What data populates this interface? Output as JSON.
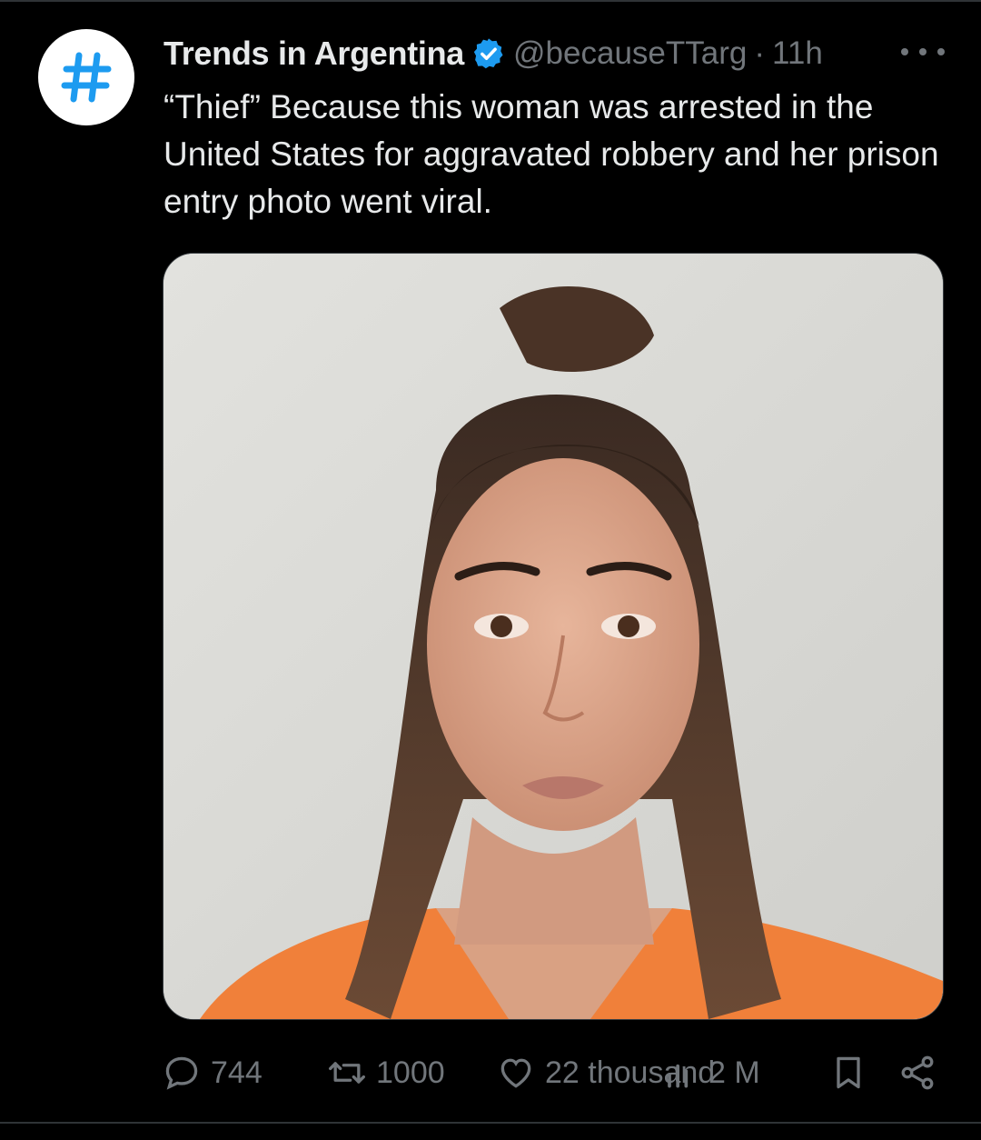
{
  "tweet": {
    "avatar_icon": "hashtag-icon",
    "display_name": "Trends in Argentina",
    "verified_icon": "verified-badge-icon",
    "handle": "@becauseTTarg",
    "separator": "·",
    "time": "11h",
    "text": "“Thief” Because this woman was arrested in the United States for aggravated robbery and her prison entry photo went viral.",
    "media_alt": "mugshot-photo"
  },
  "actions": {
    "replies": "744",
    "retweets": "1000",
    "likes": "22 thousand",
    "views": "2 M"
  },
  "colors": {
    "background": "#000000",
    "text": "#e7e9ea",
    "muted": "#71767b",
    "accent": "#1d9bf0"
  }
}
